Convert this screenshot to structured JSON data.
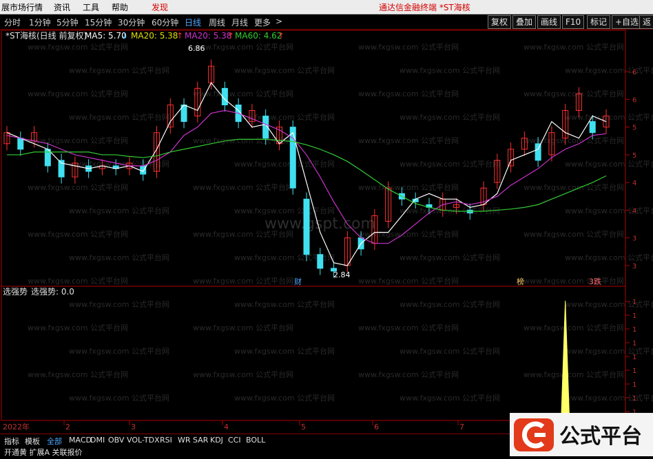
{
  "menu": {
    "items": [
      "展市场行情",
      "资讯",
      "工具",
      "帮助"
    ],
    "highlight": "发现",
    "window_title": "通达信金融终端   *ST海核"
  },
  "periods": {
    "items": [
      "分时",
      "1分钟",
      "5分钟",
      "15分钟",
      "30分钟",
      "60分钟",
      "日线",
      "周线",
      "月线",
      "更多"
    ],
    "active": "日线",
    "more_arrow": ">"
  },
  "toolbar": {
    "buttons": [
      "复权",
      "叠加",
      "画线",
      "F10",
      "标记",
      "+自选",
      "返"
    ]
  },
  "legend": {
    "stock": "*ST海核(日线 前复权)",
    "ma5": "MA5: 5.70",
    "ma5_arrow": "↓",
    "ma20": "MA20: 5.38",
    "ma20_arrow": "↑",
    "ma20b": "MA20: 5.38",
    "ma20b_arrow": "↑",
    "ma60": "MA60: 4.62",
    "ma60_arrow": "↑"
  },
  "annotations": {
    "high": "6.86",
    "low": "2.84",
    "markers": [
      "财",
      "榜",
      "3跌"
    ]
  },
  "price_axis": {
    "labels": [
      "6",
      "6",
      "5",
      "5",
      "4",
      "4",
      "3",
      "3"
    ]
  },
  "watermark": {
    "main": "www.gspt.com",
    "bg": "www.fxgsw.com 公式平台网"
  },
  "indicator": {
    "title": "选强势",
    "label": "选强势: 0.0",
    "axis_labels": [
      "1",
      "1",
      "1",
      "1",
      "1",
      "1",
      "1",
      "1",
      "1"
    ]
  },
  "date_axis": {
    "year": "2022年",
    "months": [
      "2",
      "3",
      "4",
      "5",
      "6",
      "7"
    ]
  },
  "bottom_tabs": {
    "items": [
      "指标",
      "模板",
      "全部",
      "MACD",
      "DMI",
      "OBV",
      "VOL-TDX",
      "RSI",
      "WR",
      "SAR",
      "KDJ",
      "CCI",
      "BOLL"
    ],
    "active": "全部",
    "row2": "开通黄  扩展A  关联报价"
  },
  "logo": {
    "text": "公式平台"
  },
  "colors": {
    "up": "#ff3030",
    "down": "#40e0f0",
    "ma5": "#ffffff",
    "ma20": "#cc33cc",
    "ma60": "#33cc33",
    "spike": "#ffff66",
    "axis": "#b00000"
  },
  "chart_data": {
    "type": "candlestick",
    "ma_series": [
      {
        "name": "MA5",
        "values": [
          5.4,
          5.3,
          5.2,
          5.1,
          4.85,
          4.8,
          4.75,
          4.8,
          4.75,
          4.8,
          4.7,
          5.1,
          5.6,
          5.9,
          5.8,
          6.3,
          6.0,
          5.8,
          5.5,
          5.55,
          5.2,
          5.4,
          4.5,
          3.6,
          3.05,
          3.0,
          3.4,
          3.6,
          3.6,
          3.9,
          4.2,
          4.3,
          4.2,
          4.2,
          4.05,
          4.1,
          4.3,
          4.9,
          5.0,
          5.1,
          5.6,
          5.4,
          5.3,
          5.7,
          5.6
        ]
      },
      {
        "name": "MA20",
        "values": [
          5.35,
          5.3,
          5.25,
          5.2,
          5.1,
          5.0,
          4.95,
          4.9,
          4.85,
          4.8,
          4.8,
          4.9,
          5.05,
          5.35,
          5.5,
          5.75,
          5.8,
          5.75,
          5.65,
          5.55,
          5.45,
          5.3,
          5.0,
          4.6,
          4.15,
          3.75,
          3.5,
          3.4,
          3.4,
          3.55,
          3.75,
          3.95,
          4.1,
          4.15,
          4.1,
          4.15,
          4.25,
          4.45,
          4.6,
          4.75,
          4.95,
          5.1,
          5.2,
          5.35,
          5.38
        ]
      },
      {
        "name": "MA60",
        "values": [
          5.0,
          5.0,
          5.05,
          5.05,
          5.05,
          5.05,
          5.05,
          5.0,
          5.0,
          4.97,
          4.95,
          4.98,
          5.05,
          5.1,
          5.15,
          5.2,
          5.25,
          5.28,
          5.28,
          5.28,
          5.26,
          5.24,
          5.18,
          5.1,
          5.0,
          4.88,
          4.72,
          4.55,
          4.38,
          4.25,
          4.12,
          4.05,
          4.0,
          3.98,
          3.98,
          3.98,
          4.0,
          4.02,
          4.05,
          4.1,
          4.2,
          4.3,
          4.4,
          4.5,
          4.62
        ]
      }
    ],
    "candles": [
      [
        5.2,
        5.4
      ],
      [
        5.3,
        5.1
      ],
      [
        5.25,
        5.4
      ],
      [
        5.1,
        4.8
      ],
      [
        4.9,
        4.6
      ],
      [
        4.6,
        4.85
      ],
      [
        4.8,
        4.7
      ],
      [
        4.75,
        4.8
      ],
      [
        4.8,
        4.75
      ],
      [
        4.75,
        4.85
      ],
      [
        4.8,
        4.65
      ],
      [
        4.7,
        5.4
      ],
      [
        5.5,
        5.9
      ],
      [
        5.9,
        5.6
      ],
      [
        5.7,
        6.2
      ],
      [
        6.3,
        6.6
      ],
      [
        6.2,
        5.9
      ],
      [
        5.9,
        5.6
      ],
      [
        5.6,
        5.8
      ],
      [
        5.7,
        5.3
      ],
      [
        5.2,
        5.5
      ],
      [
        5.5,
        4.4
      ],
      [
        4.2,
        3.2
      ],
      [
        3.2,
        2.95
      ],
      [
        2.95,
        2.9
      ],
      [
        3.0,
        3.5
      ],
      [
        3.5,
        3.3
      ],
      [
        3.4,
        3.9
      ],
      [
        3.8,
        4.4
      ],
      [
        4.3,
        4.2
      ],
      [
        4.2,
        4.15
      ],
      [
        4.1,
        4.05
      ],
      [
        4.0,
        4.2
      ],
      [
        4.05,
        4.1
      ],
      [
        4.0,
        3.95
      ],
      [
        4.1,
        4.4
      ],
      [
        4.5,
        4.9
      ],
      [
        4.8,
        5.1
      ],
      [
        5.1,
        5.3
      ],
      [
        5.2,
        4.9
      ],
      [
        5.0,
        5.4
      ],
      [
        5.3,
        5.8
      ],
      [
        5.8,
        6.1
      ],
      [
        5.6,
        5.4
      ],
      [
        5.5,
        5.7
      ]
    ],
    "indicator_spike": {
      "x_index": 41,
      "value": 1.0
    },
    "y_range": [
      2.8,
      6.9
    ]
  }
}
